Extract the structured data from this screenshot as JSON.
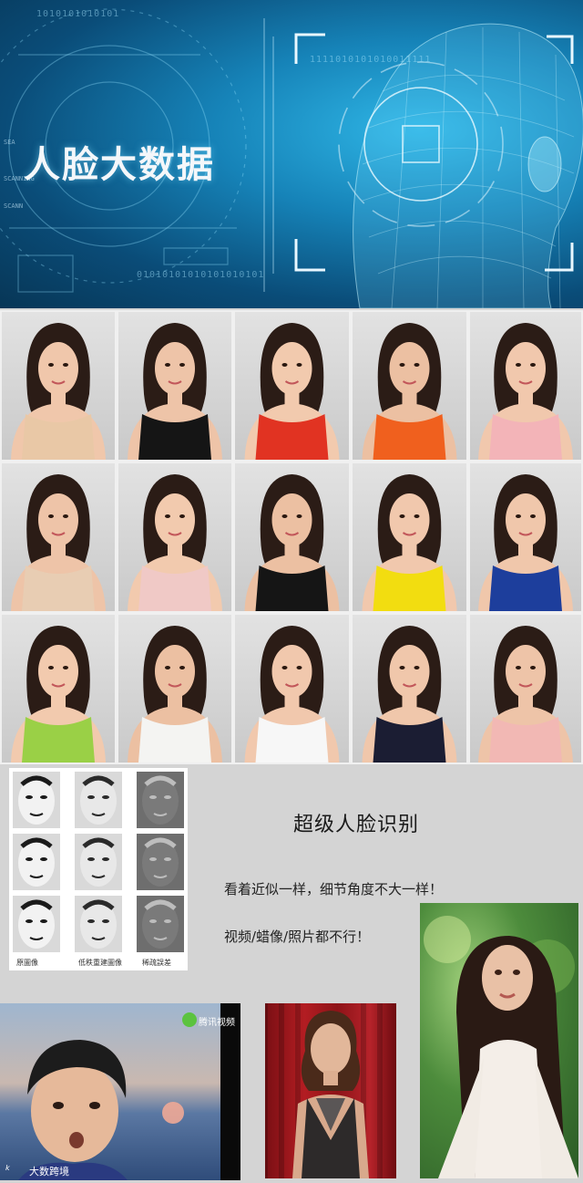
{
  "banner": {
    "title": "人脸大数据",
    "binary_lines": [
      "1111010101010011111",
      "01010101010101010101",
      "1010101010101"
    ],
    "tag_left_1": "SCANNING",
    "tag_left_2": "SEA",
    "tag_left_3": "SCANN"
  },
  "grid": {
    "dress_colors": [
      "#e9c8a6",
      "#151515",
      "#e13322",
      "#f0601e",
      "#f3b4b8",
      "#e8cdb3",
      "#f0c9c6",
      "#151515",
      "#f2dd10",
      "#1d3e9c",
      "#9ad046",
      "#f4f4f2",
      "#f7f7f7",
      "#1b1d33",
      "#f2b8b4"
    ]
  },
  "recognition": {
    "heading": "超级人脸识别",
    "line1": "看着近似一样，细节角度不大一样！",
    "line2": "视频/蜡像/照片都不行！",
    "compare_labels": [
      "原圖像",
      "低秩重建圖像",
      "稀疏誤差"
    ]
  },
  "video": {
    "player_logo_text": "腾讯视频",
    "watermark": "大数跨境",
    "watermark_prefix": "k"
  }
}
